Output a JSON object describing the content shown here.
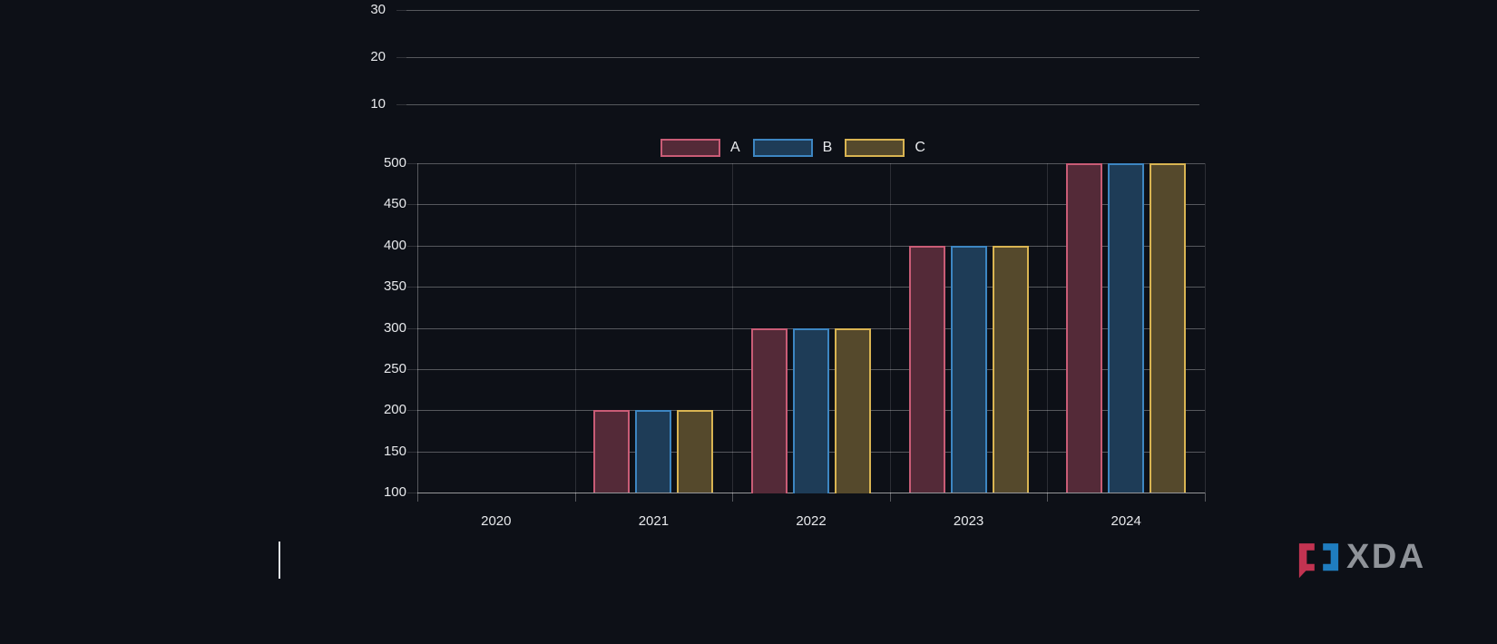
{
  "page": {
    "background": "#0d1017",
    "text_color": "#e7e9ec"
  },
  "chart_data": [
    {
      "type": "bar",
      "note": "top chart partially cut off at screen top; only gridlines and y tick labels visible, no data drawn",
      "y_ticks": [
        30,
        20,
        10
      ],
      "grid": true,
      "legend_position": "none"
    },
    {
      "type": "bar",
      "title": "",
      "categories": [
        "2020",
        "2021",
        "2022",
        "2023",
        "2024"
      ],
      "series": [
        {
          "name": "A",
          "values": [
            100,
            200,
            300,
            400,
            500
          ],
          "border": "#c95c76",
          "fill": "#542a38"
        },
        {
          "name": "B",
          "values": [
            100,
            200,
            300,
            400,
            500
          ],
          "border": "#3d86c2",
          "fill": "#1e3c57"
        },
        {
          "name": "C",
          "values": [
            100,
            200,
            300,
            400,
            500
          ],
          "border": "#d9b452",
          "fill": "#55492c"
        }
      ],
      "xlabel": "",
      "ylabel": "",
      "ylim": [
        100,
        500
      ],
      "y_tick_step": 50,
      "grid": true,
      "legend_position": "top",
      "legend_labels": [
        "A",
        "B",
        "C"
      ]
    }
  ],
  "cursor": {
    "type": "text-caret"
  },
  "watermark": {
    "text": "XDA",
    "bracket_red": "#c23351",
    "bracket_blue": "#1f7dbf",
    "text_color": "#8f9399"
  }
}
